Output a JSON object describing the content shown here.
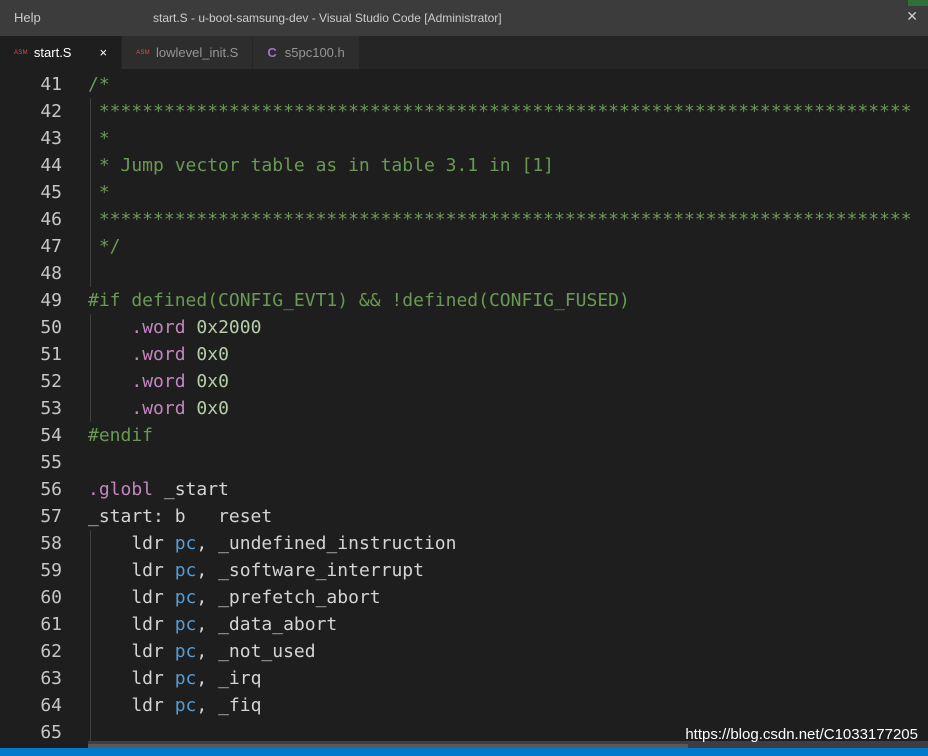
{
  "titlebar": {
    "menu_help": "Help",
    "window_title": "start.S - u-boot-samsung-dev - Visual Studio Code [Administrator]"
  },
  "tabs": [
    {
      "label": "start.S",
      "file_icon": "ASM",
      "active": true,
      "close": "×"
    },
    {
      "label": "lowlevel_init.S",
      "file_icon": "ASM",
      "active": false
    },
    {
      "label": "s5pc100.h",
      "file_icon": "C",
      "active": false
    }
  ],
  "editor": {
    "lines": [
      {
        "n": "41",
        "tokens": [
          {
            "t": "/*",
            "c": "comment"
          }
        ]
      },
      {
        "n": "42",
        "tokens": [
          {
            "t": " ***************************************************************************",
            "c": "comment"
          }
        ]
      },
      {
        "n": "43",
        "tokens": [
          {
            "t": " *",
            "c": "comment"
          }
        ]
      },
      {
        "n": "44",
        "tokens": [
          {
            "t": " * Jump vector table as in table 3.1 in [1]",
            "c": "comment"
          }
        ]
      },
      {
        "n": "45",
        "tokens": [
          {
            "t": " *",
            "c": "comment"
          }
        ]
      },
      {
        "n": "46",
        "tokens": [
          {
            "t": " ***************************************************************************",
            "c": "comment"
          }
        ]
      },
      {
        "n": "47",
        "tokens": [
          {
            "t": " */",
            "c": "comment"
          }
        ]
      },
      {
        "n": "48",
        "tokens": []
      },
      {
        "n": "49",
        "tokens": [
          {
            "t": "#if defined(CONFIG_EVT1) && !defined(CONFIG_FUSED)",
            "c": "pre"
          }
        ]
      },
      {
        "n": "50",
        "tokens": [
          {
            "t": "    ",
            "c": "plain"
          },
          {
            "t": ".word",
            "c": "dir"
          },
          {
            "t": " ",
            "c": "plain"
          },
          {
            "t": "0x2000",
            "c": "num"
          }
        ]
      },
      {
        "n": "51",
        "tokens": [
          {
            "t": "    ",
            "c": "plain"
          },
          {
            "t": ".word",
            "c": "dir"
          },
          {
            "t": " ",
            "c": "plain"
          },
          {
            "t": "0x0",
            "c": "num"
          }
        ]
      },
      {
        "n": "52",
        "tokens": [
          {
            "t": "    ",
            "c": "plain"
          },
          {
            "t": ".word",
            "c": "dir"
          },
          {
            "t": " ",
            "c": "plain"
          },
          {
            "t": "0x0",
            "c": "num"
          }
        ]
      },
      {
        "n": "53",
        "tokens": [
          {
            "t": "    ",
            "c": "plain"
          },
          {
            "t": ".word",
            "c": "dir"
          },
          {
            "t": " ",
            "c": "plain"
          },
          {
            "t": "0x0",
            "c": "num"
          }
        ]
      },
      {
        "n": "54",
        "tokens": [
          {
            "t": "#endif",
            "c": "pre"
          }
        ]
      },
      {
        "n": "55",
        "tokens": []
      },
      {
        "n": "56",
        "tokens": [
          {
            "t": ".globl",
            "c": "dir"
          },
          {
            "t": " _start",
            "c": "plain"
          }
        ]
      },
      {
        "n": "57",
        "tokens": [
          {
            "t": "_start: b   reset",
            "c": "plain"
          }
        ]
      },
      {
        "n": "58",
        "tokens": [
          {
            "t": "    ldr ",
            "c": "plain"
          },
          {
            "t": "pc",
            "c": "reg"
          },
          {
            "t": ", _undefined_instruction",
            "c": "plain"
          }
        ]
      },
      {
        "n": "59",
        "tokens": [
          {
            "t": "    ldr ",
            "c": "plain"
          },
          {
            "t": "pc",
            "c": "reg"
          },
          {
            "t": ", _software_interrupt",
            "c": "plain"
          }
        ]
      },
      {
        "n": "60",
        "tokens": [
          {
            "t": "    ldr ",
            "c": "plain"
          },
          {
            "t": "pc",
            "c": "reg"
          },
          {
            "t": ", _prefetch_abort",
            "c": "plain"
          }
        ]
      },
      {
        "n": "61",
        "tokens": [
          {
            "t": "    ldr ",
            "c": "plain"
          },
          {
            "t": "pc",
            "c": "reg"
          },
          {
            "t": ", _data_abort",
            "c": "plain"
          }
        ]
      },
      {
        "n": "62",
        "tokens": [
          {
            "t": "    ldr ",
            "c": "plain"
          },
          {
            "t": "pc",
            "c": "reg"
          },
          {
            "t": ", _not_used",
            "c": "plain"
          }
        ]
      },
      {
        "n": "63",
        "tokens": [
          {
            "t": "    ldr ",
            "c": "plain"
          },
          {
            "t": "pc",
            "c": "reg"
          },
          {
            "t": ", _irq",
            "c": "plain"
          }
        ]
      },
      {
        "n": "64",
        "tokens": [
          {
            "t": "    ldr ",
            "c": "plain"
          },
          {
            "t": "pc",
            "c": "reg"
          },
          {
            "t": ", _fiq",
            "c": "plain"
          }
        ]
      },
      {
        "n": "65",
        "tokens": []
      }
    ]
  },
  "watermark": "https://blog.csdn.net/C1033177205",
  "colors": {
    "comment": "#6a9955",
    "directive": "#c586c0",
    "number": "#b5cea8",
    "register": "#569cd6",
    "text": "#d4d4d4",
    "background": "#1e1e1e",
    "status_bar": "#007acc"
  }
}
